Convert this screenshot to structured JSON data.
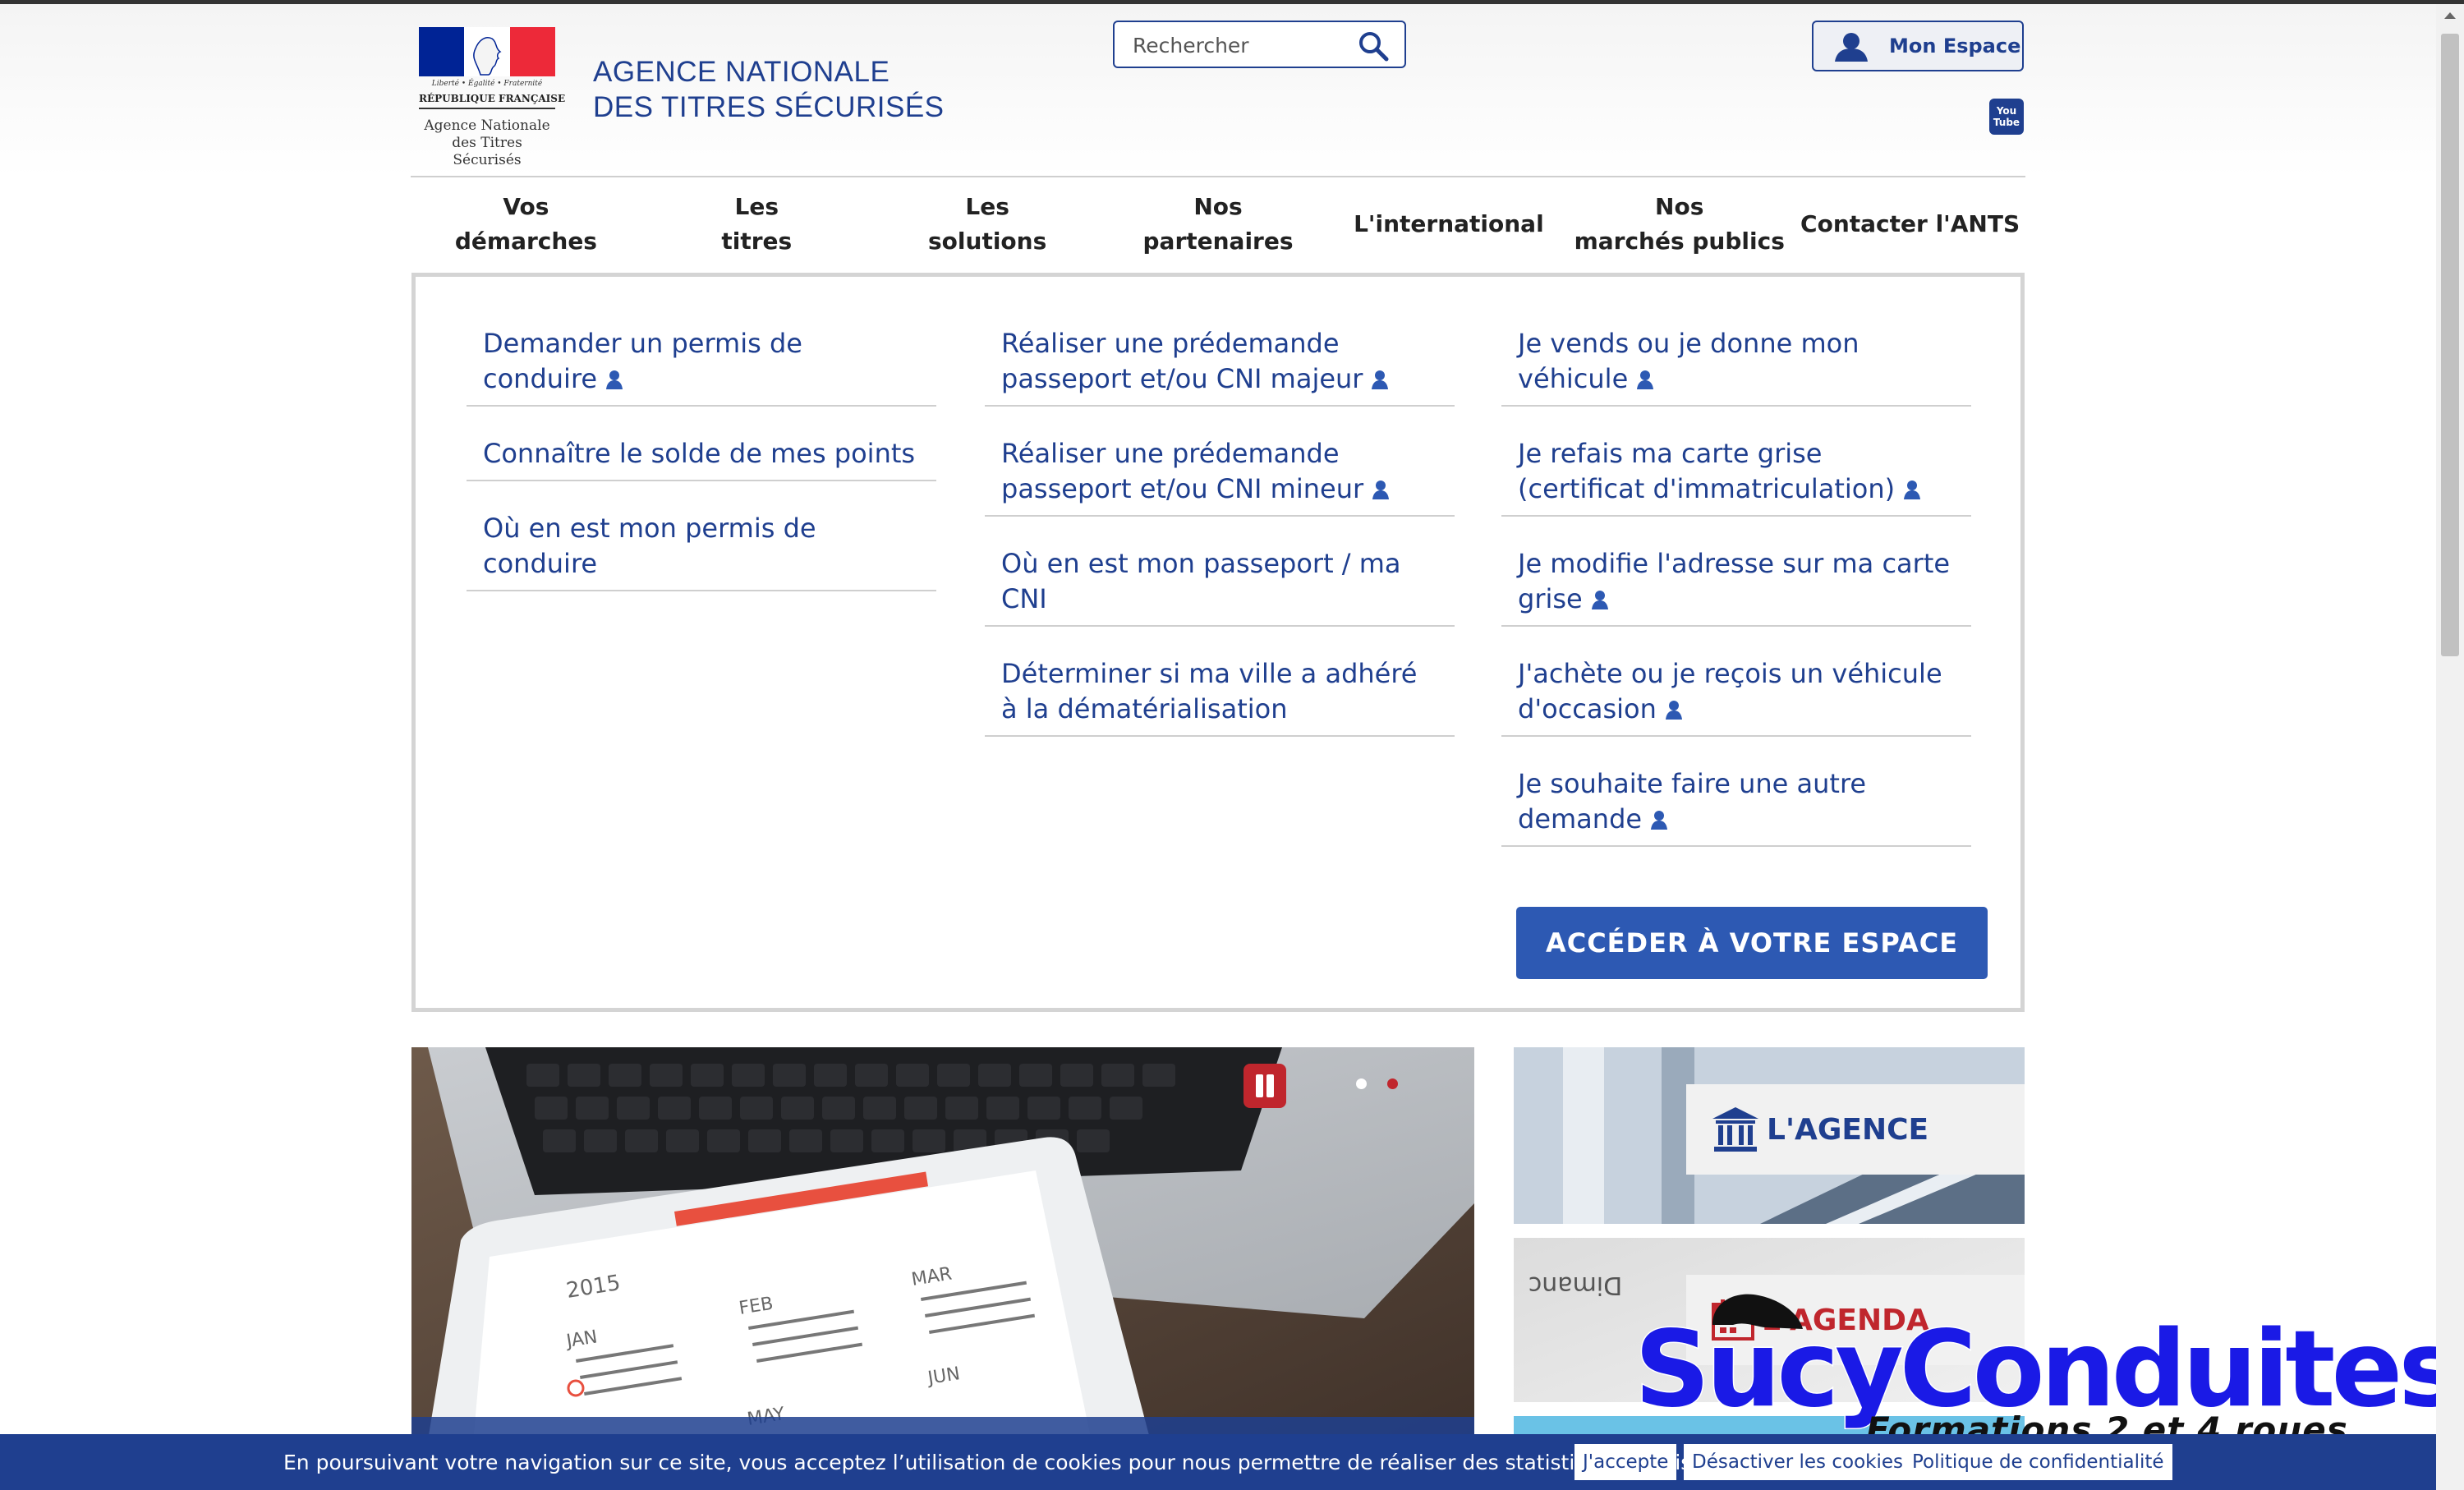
{
  "header": {
    "logo": {
      "motto": "Liberté • Égalité • Fraternité",
      "republic": "RÉPUBLIQUE FRANÇAISE",
      "agency_small_1": "Agence Nationale",
      "agency_small_2": "des Titres Sécurisés",
      "flag_colors": [
        "#002395",
        "#ffffff",
        "#ed2939"
      ]
    },
    "agency_line1": "AGENCE NATIONALE",
    "agency_line2": "DES TITRES SÉCURISÉS",
    "search": {
      "placeholder": "Rechercher",
      "icon": "search-icon"
    },
    "espace_button": "Mon Espace",
    "youtube": {
      "line1": "You",
      "line2": "Tube"
    }
  },
  "nav": {
    "items": [
      {
        "line1": "Vos",
        "line2": "démarches"
      },
      {
        "line1": "Les",
        "line2": "titres"
      },
      {
        "line1": "Les",
        "line2": "solutions"
      },
      {
        "line1": "Nos",
        "line2": "partenaires"
      },
      {
        "line1": "L'international",
        "line2": ""
      },
      {
        "line1": "Nos",
        "line2": "marchés publics"
      },
      {
        "line1": "Contacter l'ANTS",
        "line2": ""
      }
    ]
  },
  "dropdown": {
    "col1": [
      {
        "label": "Demander un permis de conduire",
        "user_icon": true
      },
      {
        "label": "Connaître le solde de mes points",
        "user_icon": false
      },
      {
        "label": "Où en est mon permis de conduire",
        "user_icon": false
      }
    ],
    "col2": [
      {
        "label": "Réaliser une prédemande passeport et/ou CNI majeur",
        "user_icon": true
      },
      {
        "label": "Réaliser une prédemande passeport et/ou CNI mineur",
        "user_icon": true
      },
      {
        "label": "Où en est mon passeport / ma CNI",
        "user_icon": false
      },
      {
        "label": "Déterminer si ma ville a adhéré à la dématérialisation",
        "user_icon": false
      }
    ],
    "col3": [
      {
        "label": "Je vends ou je donne mon véhicule",
        "user_icon": true
      },
      {
        "label": "Je refais ma carte grise (certificat d'immatriculation)",
        "user_icon": true
      },
      {
        "label": "Je modifie l'adresse sur ma carte grise",
        "user_icon": true
      },
      {
        "label": "J'achète ou je reçois un véhicule d'occasion",
        "user_icon": true
      },
      {
        "label": "Je souhaite faire une autre demande",
        "user_icon": true
      }
    ],
    "access_button": "ACCÉDER À VOTRE ESPACE"
  },
  "slider": {
    "calendar_year": "2015",
    "months": [
      "JAN",
      "FEB",
      "MAR",
      "MAY",
      "JUN"
    ],
    "active_dot": 1,
    "dot_colors": {
      "inactive": "#ffffff",
      "active": "#c0262d"
    }
  },
  "tiles": [
    {
      "label": "L'AGENCE",
      "icon": "bank-icon"
    },
    {
      "label": "L'AGENDA",
      "icon": "calendar-icon",
      "bg_text": "Dimanc"
    }
  ],
  "cookie_bar": {
    "text": "En poursuivant votre navigation sur ce site, vous acceptez l’utilisation de cookies pour nous permettre de réaliser des statistiques de visites.",
    "accept": "J'accepte",
    "disable": "Désactiver les cookies",
    "policy": "Politique de confidentialité"
  },
  "watermark": {
    "main": "SucyConduites",
    "sub": "Formations 2 et 4 roues"
  },
  "colors": {
    "brand_blue": "#1f3f8f",
    "button_blue": "#2d59b3",
    "accent_red": "#c0262d"
  }
}
